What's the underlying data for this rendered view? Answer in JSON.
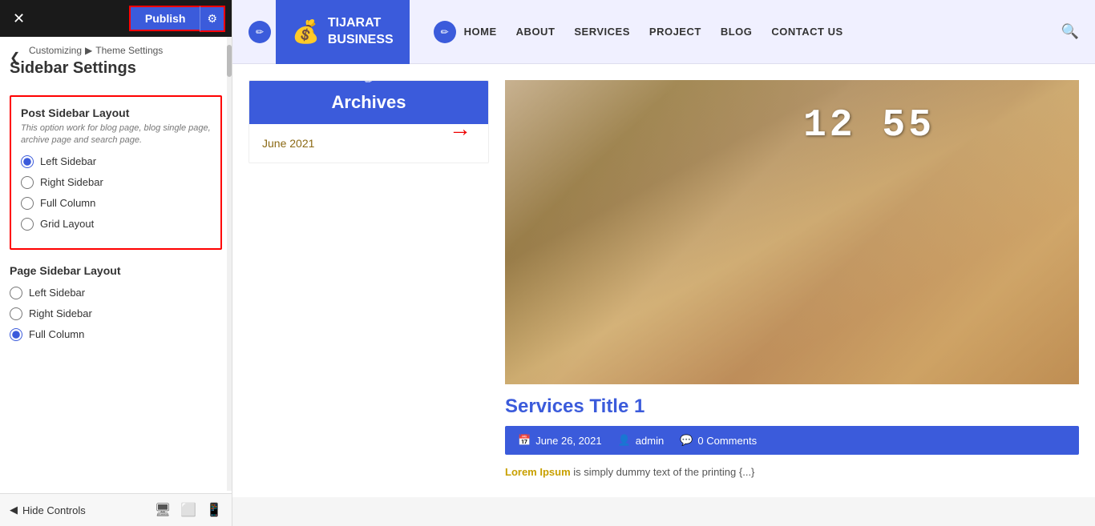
{
  "toolbar": {
    "close_label": "✕",
    "publish_label": "Publish",
    "gear_label": "⚙"
  },
  "breadcrumb": {
    "parent": "Customizing",
    "separator": "▶",
    "current": "Theme Settings"
  },
  "back_button": "❮",
  "panel_title": "Sidebar Settings",
  "post_sidebar": {
    "title": "Post Sidebar Layout",
    "description": "This option work for blog page, blog single page, archive page and search page.",
    "options": [
      {
        "label": "Left Sidebar",
        "value": "left",
        "checked": true
      },
      {
        "label": "Right Sidebar",
        "value": "right",
        "checked": false
      },
      {
        "label": "Full Column",
        "value": "full",
        "checked": false
      },
      {
        "label": "Grid Layout",
        "value": "grid",
        "checked": false
      }
    ]
  },
  "page_sidebar": {
    "title": "Page Sidebar Layout",
    "options": [
      {
        "label": "Left Sidebar",
        "value": "left",
        "checked": false
      },
      {
        "label": "Right Sidebar",
        "value": "right",
        "checked": false
      },
      {
        "label": "Full Column",
        "value": "full",
        "checked": true
      }
    ]
  },
  "bottom": {
    "hide_controls": "Hide Controls",
    "hide_icon": "◀"
  },
  "site": {
    "logo_icon": "💰",
    "logo_line1": "TIJARAT",
    "logo_line2": "BUSINESS",
    "nav_items": [
      "HOME",
      "ABOUT",
      "SERVICES",
      "PROJECT",
      "BLOG",
      "CONTACT US"
    ],
    "widget_title": "Archives",
    "archive_link": "June 2021",
    "article_title": "Services Title 1",
    "article_date": "June 26, 2021",
    "article_author": "admin",
    "article_comments": "0 Comments",
    "article_excerpt_start": "Lorem Ipsum",
    "article_excerpt_rest": " is simply dummy text of the printing ",
    "article_excerpt_dots": "{...}",
    "clock": "12  55"
  }
}
